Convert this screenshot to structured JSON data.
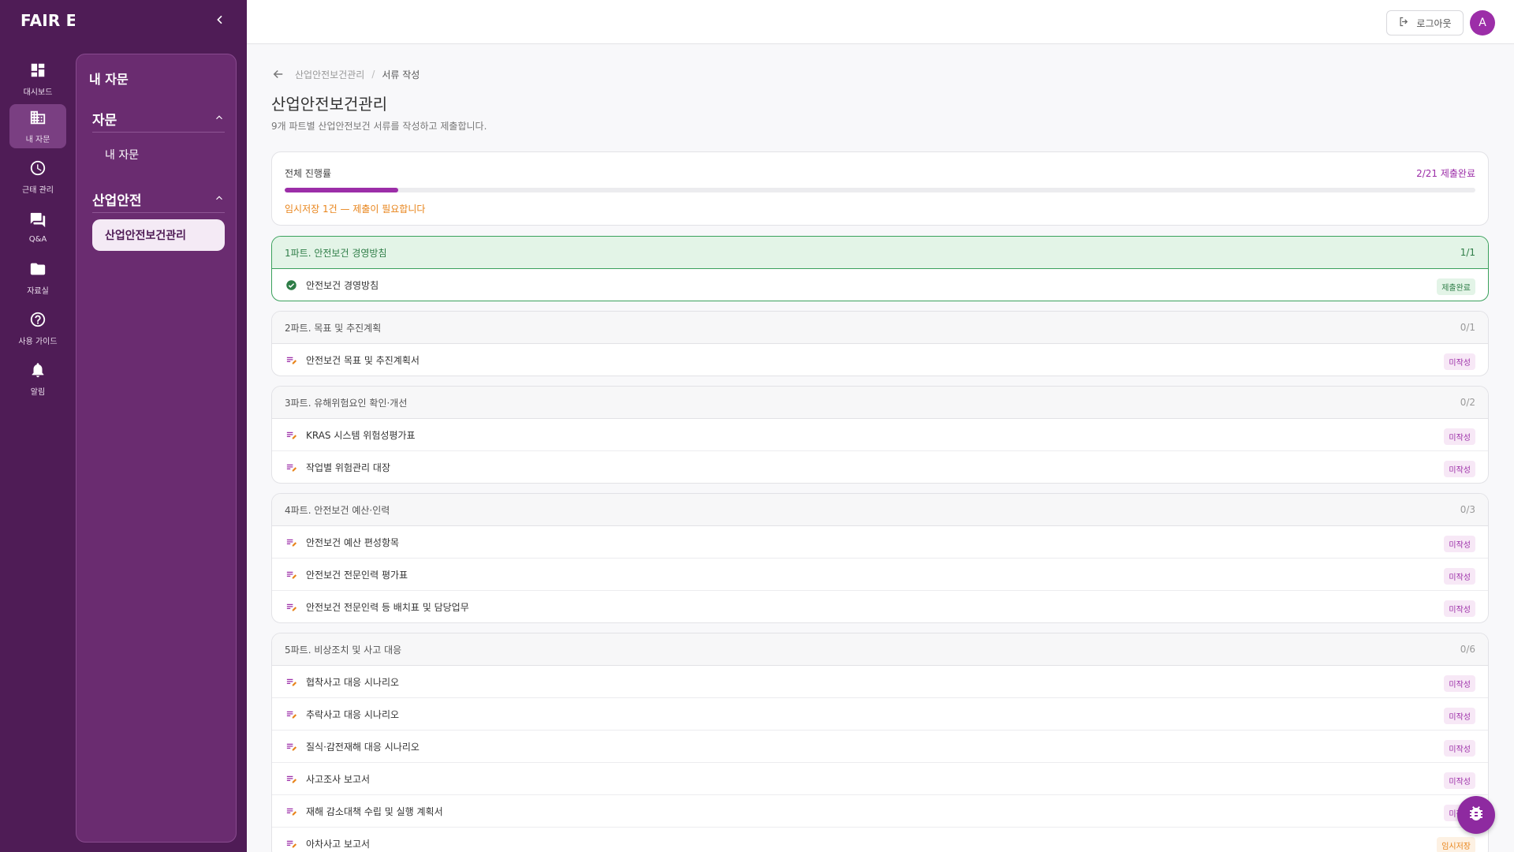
{
  "app": {
    "brand": "FAIR ERP"
  },
  "rail": {
    "items": [
      {
        "label": "대시보드",
        "icon": "dashboard-icon"
      },
      {
        "label": "내 자문",
        "icon": "building-icon"
      },
      {
        "label": "근태 관리",
        "icon": "clock-icon"
      },
      {
        "label": "Q&A",
        "icon": "chat-icon"
      },
      {
        "label": "자료실",
        "icon": "folder-icon"
      },
      {
        "label": "사용 가이드",
        "icon": "help-icon"
      },
      {
        "label": "알림",
        "icon": "bell-icon"
      }
    ]
  },
  "sidepanel": {
    "title": "내 자문",
    "groups": [
      {
        "label": "자문",
        "items": [
          "내 자문"
        ]
      },
      {
        "label": "산업안전",
        "items": [
          "산업안전보건관리"
        ]
      }
    ]
  },
  "topbar": {
    "logout_label": "로그아웃",
    "avatar_initial": "A"
  },
  "breadcrumb": {
    "parent": "산업안전보건관리",
    "separator": "/",
    "current": "서류 작성"
  },
  "page": {
    "title": "산업안전보건관리",
    "description": "9개 파트별 산업안전보건 서류를 작성하고 제출합니다."
  },
  "progress": {
    "label": "전체 진행률",
    "count_text": "2/21 제출완료",
    "fraction": 0.0952,
    "warning": "임시저장 1건 — 제출이 필요합니다"
  },
  "status_labels": {
    "done": "제출완료",
    "todo": "미작성",
    "temp": "임시저장"
  },
  "colors": {
    "brand": "#4f1c56",
    "accent": "#9c2ea8",
    "success": "#2e7d47",
    "warning": "#e8841a"
  },
  "parts": [
    {
      "title": "1파트. 안전보건 경영방침",
      "count": "1/1",
      "done": true,
      "docs": [
        {
          "name": "안전보건 경영방침",
          "status": "done"
        }
      ]
    },
    {
      "title": "2파트. 목표 및 추진계획",
      "count": "0/1",
      "done": false,
      "docs": [
        {
          "name": "안전보건 목표 및 추진계획서",
          "status": "todo"
        }
      ]
    },
    {
      "title": "3파트. 유해위험요인 확인·개선",
      "count": "0/2",
      "done": false,
      "docs": [
        {
          "name": "KRAS 시스템 위험성평가표",
          "status": "todo"
        },
        {
          "name": "작업별 위험관리 대장",
          "status": "todo"
        }
      ]
    },
    {
      "title": "4파트. 안전보건 예산·인력",
      "count": "0/3",
      "done": false,
      "docs": [
        {
          "name": "안전보건 예산 편성항목",
          "status": "todo"
        },
        {
          "name": "안전보건 전문인력 평가표",
          "status": "todo"
        },
        {
          "name": "안전보건 전문인력 등 배치표 및 담당업무",
          "status": "todo"
        }
      ]
    },
    {
      "title": "5파트. 비상조치 및 사고 대응",
      "count": "0/6",
      "done": false,
      "docs": [
        {
          "name": "협착사고 대응 시나리오",
          "status": "todo"
        },
        {
          "name": "추락사고 대응 시나리오",
          "status": "todo"
        },
        {
          "name": "질식·감전재해 대응 시나리오",
          "status": "todo"
        },
        {
          "name": "사고조사 보고서",
          "status": "todo"
        },
        {
          "name": "재해 감소대책 수립 및 실행 계획서",
          "status": "todo"
        },
        {
          "name": "아차사고 보고서",
          "status": "temp"
        }
      ]
    }
  ]
}
